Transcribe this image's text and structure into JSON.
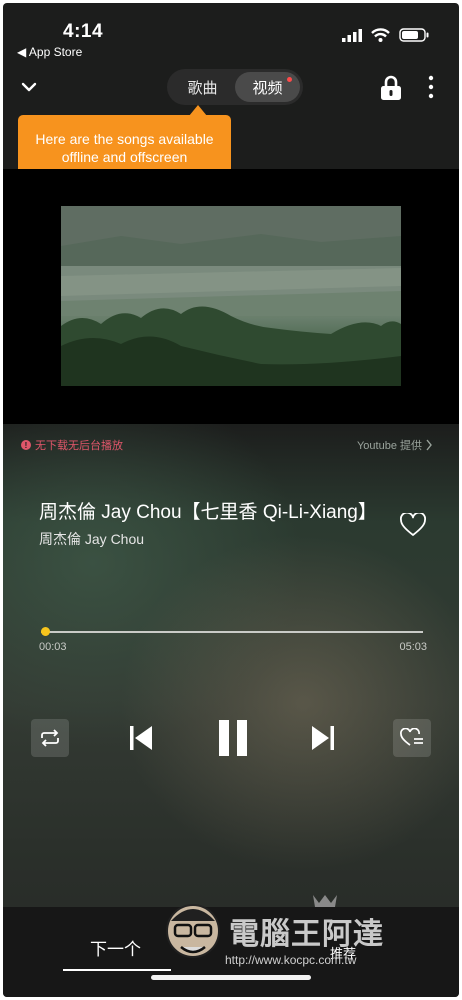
{
  "status_bar": {
    "time": "4:14",
    "back_label": "◀ App Store"
  },
  "header": {
    "tabs": [
      {
        "label": "歌曲",
        "active": false
      },
      {
        "label": "视频",
        "active": true,
        "dot_color": "#ff4b4b"
      }
    ]
  },
  "tooltip": {
    "text": "Here are the songs available offline and offscreen",
    "color": "#f7931e"
  },
  "notice": {
    "text": "无下载无后台播放",
    "color": "#e0566a"
  },
  "provider": {
    "text": "Youtube 提供"
  },
  "song": {
    "title": "周杰倫 Jay Chou【七里香 Qi-Li-Xiang】",
    "artist": "周杰倫 Jay Chou"
  },
  "playback": {
    "current_time": "00:03",
    "total_time": "05:03",
    "progress_fraction": 0.01,
    "accent_color": "#f7c51d",
    "state": "playing"
  },
  "bottom": {
    "next_label": "下一个",
    "recommend_label": "推荐"
  },
  "watermark": {
    "text": "電腦王阿達",
    "url": "http://www.kocpc.com.tw"
  }
}
